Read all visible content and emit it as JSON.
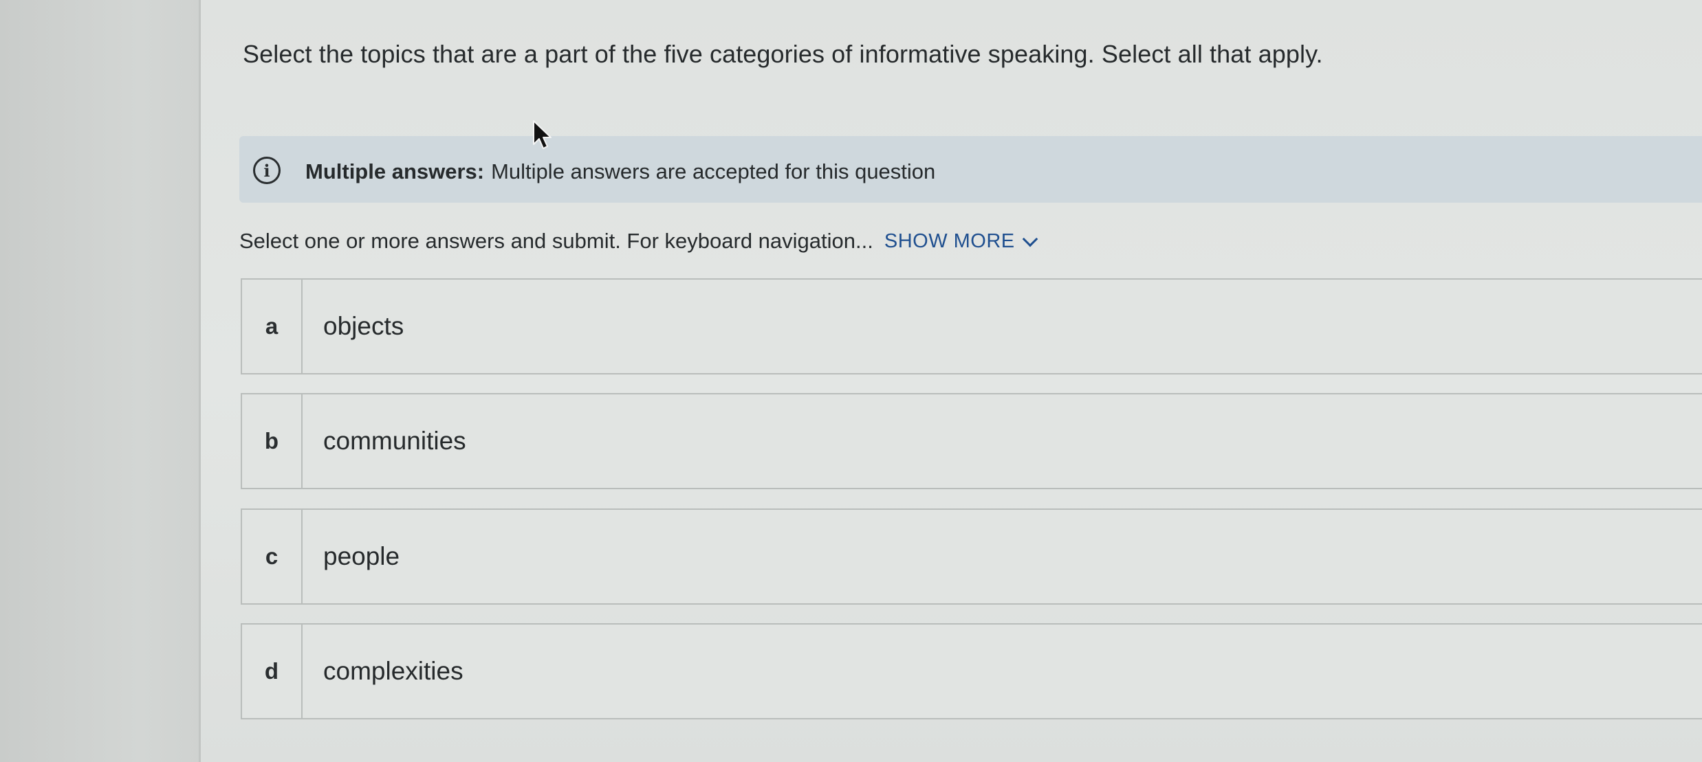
{
  "question": {
    "text": "Select the topics that are a part of the five categories of informative speaking. Select all that apply."
  },
  "info_banner": {
    "icon": "info-icon",
    "label": "Multiple answers:",
    "text": "Multiple answers are accepted for this question"
  },
  "instructions": {
    "text": "Select one or more answers and submit. For keyboard navigation...",
    "show_more_label": "SHOW MORE"
  },
  "answers": [
    {
      "letter": "a",
      "text": "objects"
    },
    {
      "letter": "b",
      "text": "communities"
    },
    {
      "letter": "c",
      "text": "people"
    },
    {
      "letter": "d",
      "text": "complexities"
    }
  ],
  "colors": {
    "link": "#1f4f8f",
    "banner_background": "#cfd8dd"
  }
}
